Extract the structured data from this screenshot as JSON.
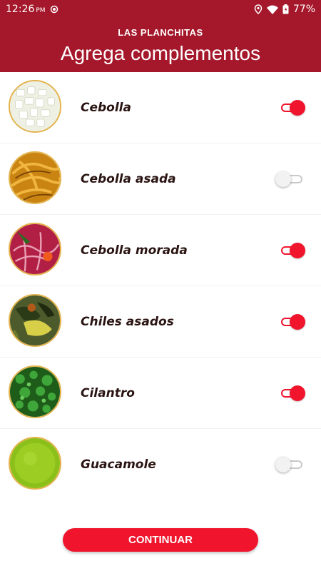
{
  "status_bar": {
    "time": "12:26",
    "ampm": "PM",
    "battery": "77%"
  },
  "header": {
    "brand": "LAS PLANCHITAS",
    "title": "Agrega complementos",
    "color": "#a5172a"
  },
  "items": [
    {
      "name": "Cebolla",
      "selected": true,
      "image": "white-onion"
    },
    {
      "name": "Cebolla asada",
      "selected": false,
      "image": "grilled-onion"
    },
    {
      "name": "Cebolla morada",
      "selected": true,
      "image": "red-onion"
    },
    {
      "name": "Chiles asados",
      "selected": true,
      "image": "roasted-chiles"
    },
    {
      "name": "Cilantro",
      "selected": true,
      "image": "cilantro"
    },
    {
      "name": "Guacamole",
      "selected": false,
      "image": "guacamole"
    }
  ],
  "continue_label": "CONTINUAR",
  "accent_color": "#f0142d"
}
